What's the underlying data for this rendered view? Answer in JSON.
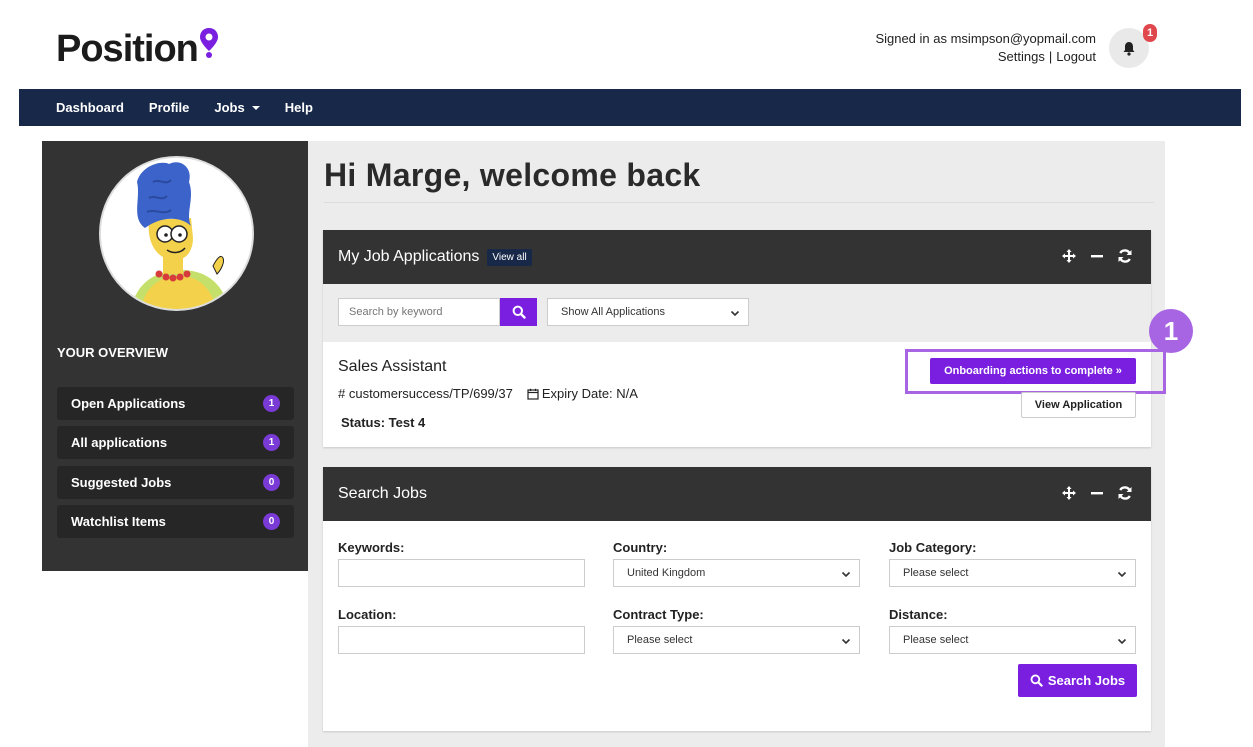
{
  "header": {
    "logo_text": "Position",
    "signed_in_text": "Signed in as msimpson@yopmail.com",
    "settings_label": "Settings",
    "separator": "|",
    "logout_label": "Logout",
    "notification_count": "1"
  },
  "nav": {
    "items": [
      {
        "label": "Dashboard"
      },
      {
        "label": "Profile"
      },
      {
        "label": "Jobs"
      },
      {
        "label": "Help"
      }
    ]
  },
  "sidebar": {
    "overview_title": "YOUR OVERVIEW",
    "items": [
      {
        "label": "Open Applications",
        "count": "1"
      },
      {
        "label": "All applications",
        "count": "1"
      },
      {
        "label": "Suggested Jobs",
        "count": "0"
      },
      {
        "label": "Watchlist Items",
        "count": "0"
      }
    ]
  },
  "main": {
    "welcome": "Hi Marge, welcome back",
    "applications_panel": {
      "title": "My Job Applications",
      "view_all_label": "View all",
      "search_placeholder": "Search by keyword",
      "filter_value": "Show All Applications",
      "job": {
        "title": "Sales Assistant",
        "reference": "# customersuccess/TP/699/37",
        "expiry": "Expiry Date: N/A",
        "status": "Status: Test 4",
        "onboarding_label": "Onboarding actions to complete »",
        "view_label": "View Application"
      }
    },
    "search_panel": {
      "title": "Search Jobs",
      "keywords_label": "Keywords:",
      "country_label": "Country:",
      "country_value": "United Kingdom",
      "category_label": "Job Category:",
      "category_value": "Please select",
      "location_label": "Location:",
      "contract_label": "Contract Type:",
      "contract_value": "Please select",
      "distance_label": "Distance:",
      "distance_value": "Please select",
      "search_button_label": "Search Jobs"
    }
  },
  "callout": {
    "number": "1"
  },
  "colors": {
    "navbar": "#172848",
    "accent": "#7a1fe0",
    "panel_header": "#333333",
    "highlight": "#a764e3",
    "badge_red": "#e0474c"
  }
}
